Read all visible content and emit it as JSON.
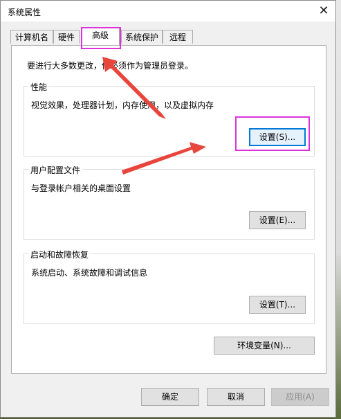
{
  "window": {
    "title": "系统属性",
    "close_glyph": "✕"
  },
  "tabs": [
    {
      "label": "计算机名"
    },
    {
      "label": "硬件"
    },
    {
      "label": "高级",
      "active": true
    },
    {
      "label": "系统保护"
    },
    {
      "label": "远程"
    }
  ],
  "panel": {
    "admin_note": "要进行大多数更改，你必须作为管理员登录。",
    "performance": {
      "title": "性能",
      "description": "视觉效果，处理器计划，内存使用，以及虚拟内存",
      "button": "设置(S)..."
    },
    "user_profiles": {
      "title": "用户配置文件",
      "description": "与登录帐户相关的桌面设置",
      "button": "设置(E)..."
    },
    "startup_recovery": {
      "title": "启动和故障恢复",
      "description": "系统启动、系统故障和调试信息",
      "button": "设置(T)..."
    },
    "env_button": "环境变量(N)..."
  },
  "footer": {
    "ok": "确定",
    "cancel": "取消",
    "apply": "应用(A)"
  },
  "colors": {
    "highlight": "#dd33dd",
    "arrow": "#e8453c",
    "focus": "#0078d7"
  }
}
